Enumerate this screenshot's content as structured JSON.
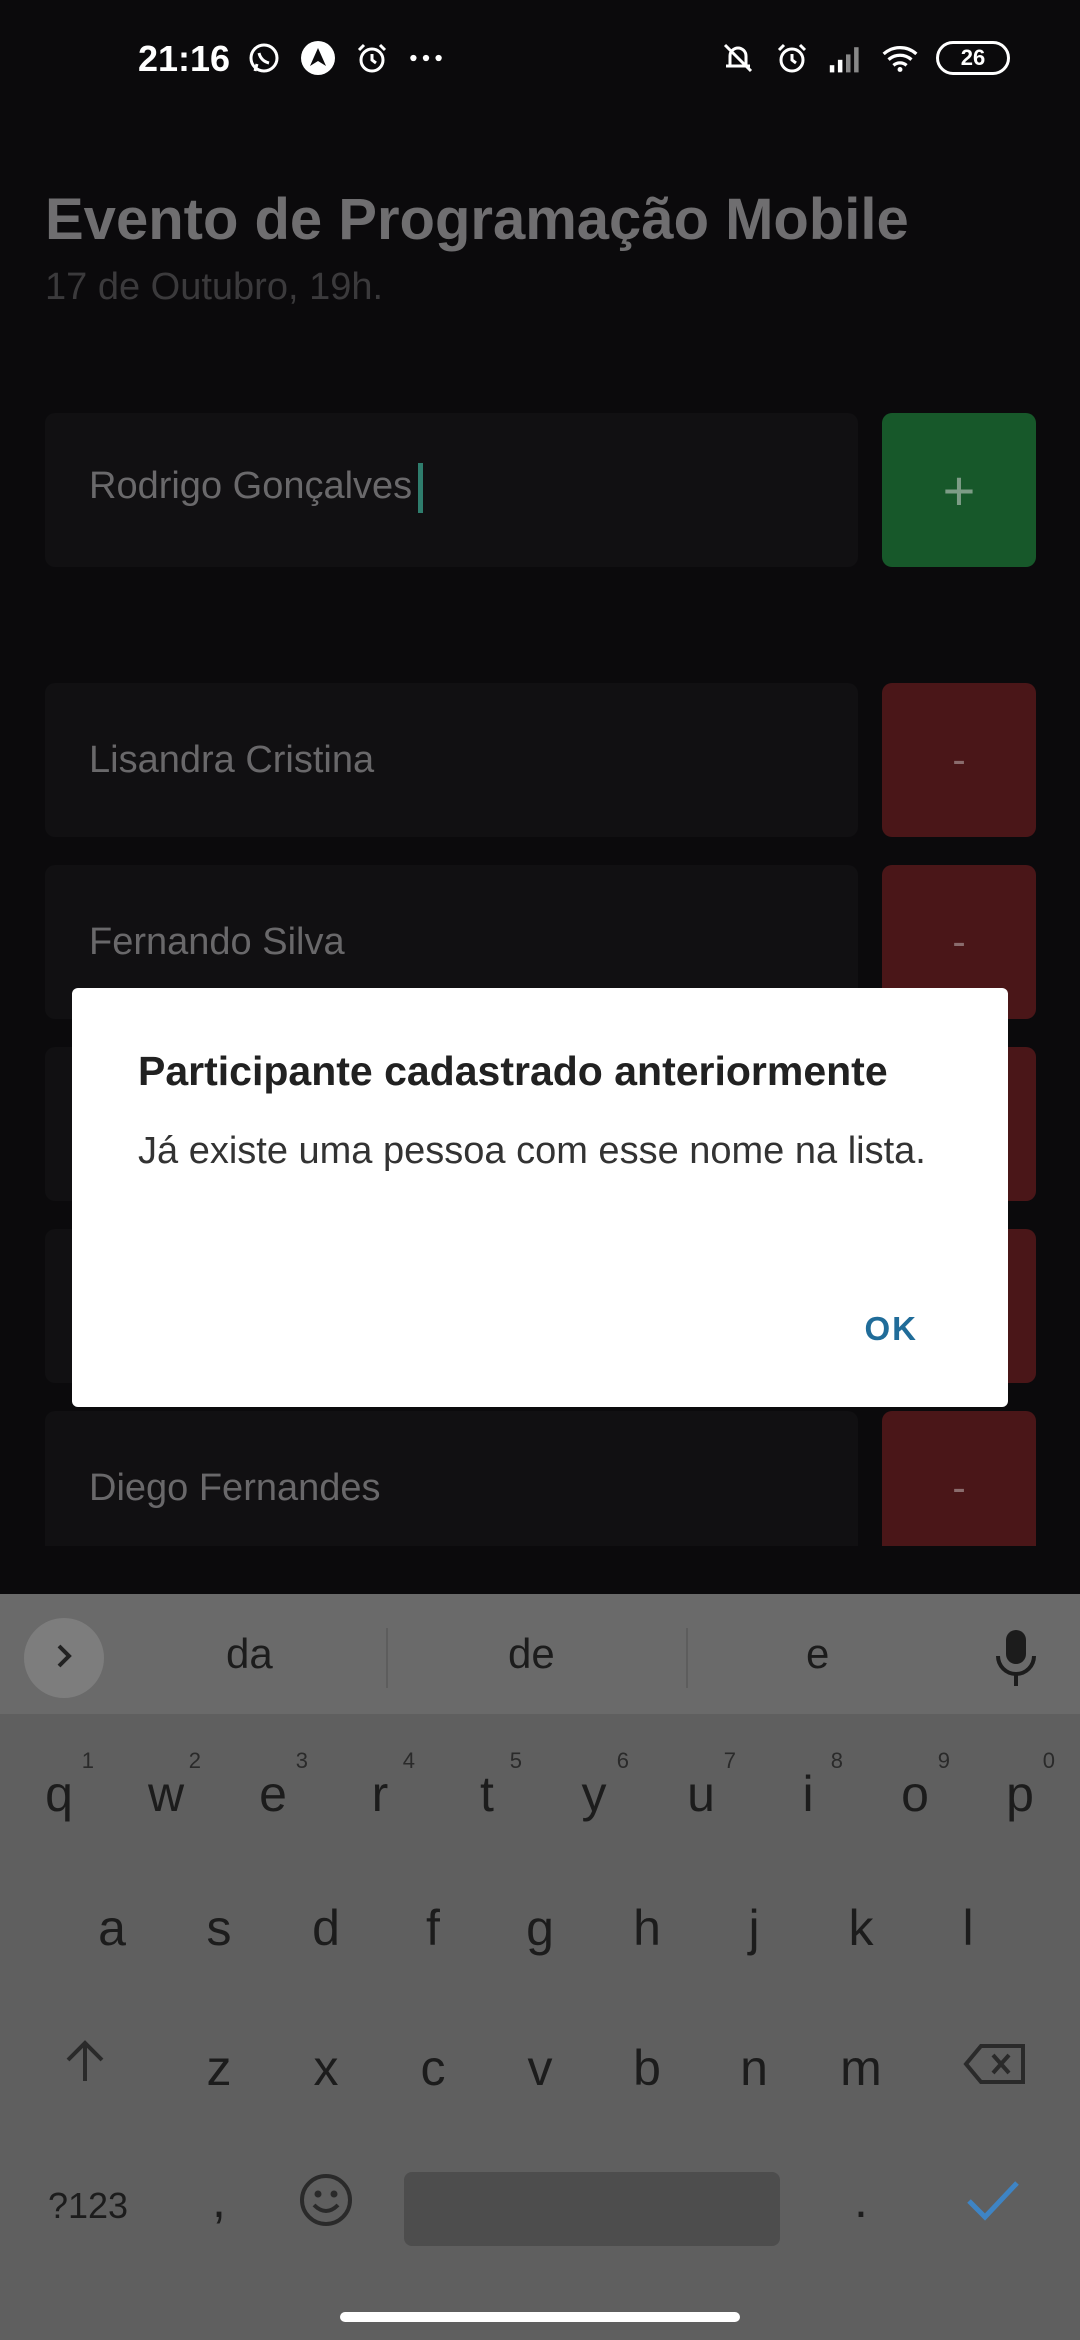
{
  "status_bar": {
    "time": "21:16",
    "left_icons": [
      "whatsapp-icon",
      "navigation-icon",
      "alarm-icon",
      "more-dots-icon"
    ],
    "right_icons": [
      "mute-icon",
      "alarm-icon",
      "signal-icon",
      "wifi-icon"
    ],
    "battery": "26"
  },
  "event": {
    "title": "Evento de Programação Mobile",
    "date": "17 de Outubro, 19h."
  },
  "input": {
    "value": "Rodrigo Gonçalves",
    "add_label": "+"
  },
  "participants": [
    {
      "name": "Lisandra Cristina",
      "remove_label": "-"
    },
    {
      "name": "Fernando Silva",
      "remove_label": "-"
    },
    {
      "name": "",
      "remove_label": ""
    },
    {
      "name": "",
      "remove_label": ""
    },
    {
      "name": "Diego Fernandes",
      "remove_label": "-"
    }
  ],
  "dialog": {
    "title": "Participante cadastrado anteriormente",
    "message": "Já existe uma pessoa com esse nome na lista.",
    "ok_label": "OK"
  },
  "keyboard": {
    "suggestions": [
      "da",
      "de",
      "e"
    ],
    "row1": [
      {
        "key": "q",
        "hint": "1"
      },
      {
        "key": "w",
        "hint": "2"
      },
      {
        "key": "e",
        "hint": "3"
      },
      {
        "key": "r",
        "hint": "4"
      },
      {
        "key": "t",
        "hint": "5"
      },
      {
        "key": "y",
        "hint": "6"
      },
      {
        "key": "u",
        "hint": "7"
      },
      {
        "key": "i",
        "hint": "8"
      },
      {
        "key": "o",
        "hint": "9"
      },
      {
        "key": "p",
        "hint": "0"
      }
    ],
    "row2": [
      "a",
      "s",
      "d",
      "f",
      "g",
      "h",
      "j",
      "k",
      "l"
    ],
    "row3": [
      "z",
      "x",
      "c",
      "v",
      "b",
      "n",
      "m"
    ],
    "symbols_label": "?123",
    "comma_label": ",",
    "period_label": "."
  },
  "colors": {
    "add_button": "#17582a",
    "remove_button": "#4a1618",
    "dialog_ok": "#206c99",
    "enter_check": "#3e84c4"
  }
}
